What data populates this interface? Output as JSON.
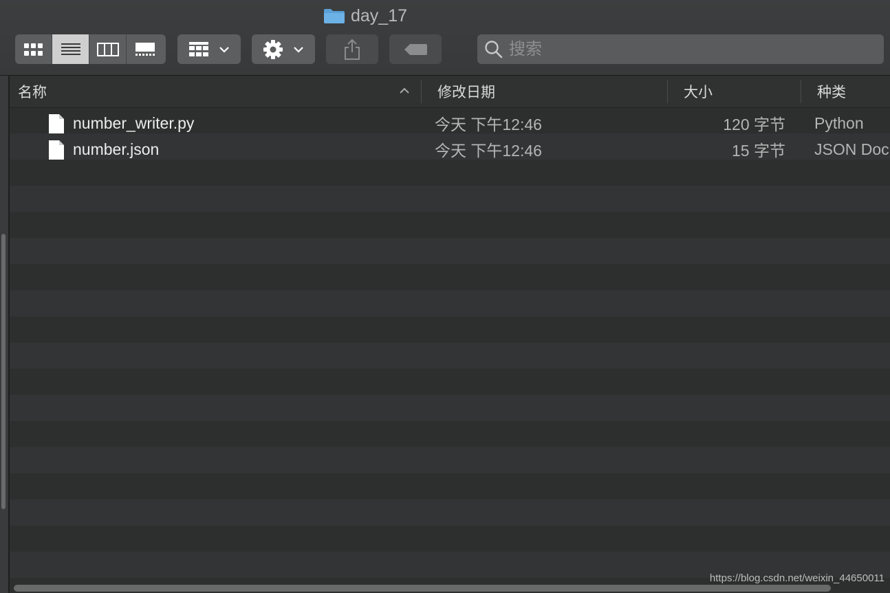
{
  "window": {
    "title": "day_17"
  },
  "toolbar": {
    "view_modes": [
      {
        "icon": "icon-view-icon",
        "active": false
      },
      {
        "icon": "list-view-icon",
        "active": true
      },
      {
        "icon": "column-view-icon",
        "active": false
      },
      {
        "icon": "gallery-view-icon",
        "active": false
      }
    ],
    "group_by_icon": "group-by-icon",
    "action_icon": "gear-icon",
    "share_icon": "share-icon",
    "tags_icon": "tag-icon",
    "search": {
      "placeholder": "搜索",
      "value": ""
    }
  },
  "columns": {
    "name": "名称",
    "date": "修改日期",
    "size": "大小",
    "kind": "种类"
  },
  "files": [
    {
      "name": "number_writer.py",
      "date": "今天 下午12:46",
      "size": "120 字节",
      "kind": "Python"
    },
    {
      "name": "number.json",
      "date": "今天 下午12:46",
      "size": "15 字节",
      "kind": "JSON Doc"
    }
  ],
  "watermark": "https://blog.csdn.net/weixin_44650011",
  "colors": {
    "background": "#2b2c2c",
    "folder": "#5aa0d6"
  }
}
